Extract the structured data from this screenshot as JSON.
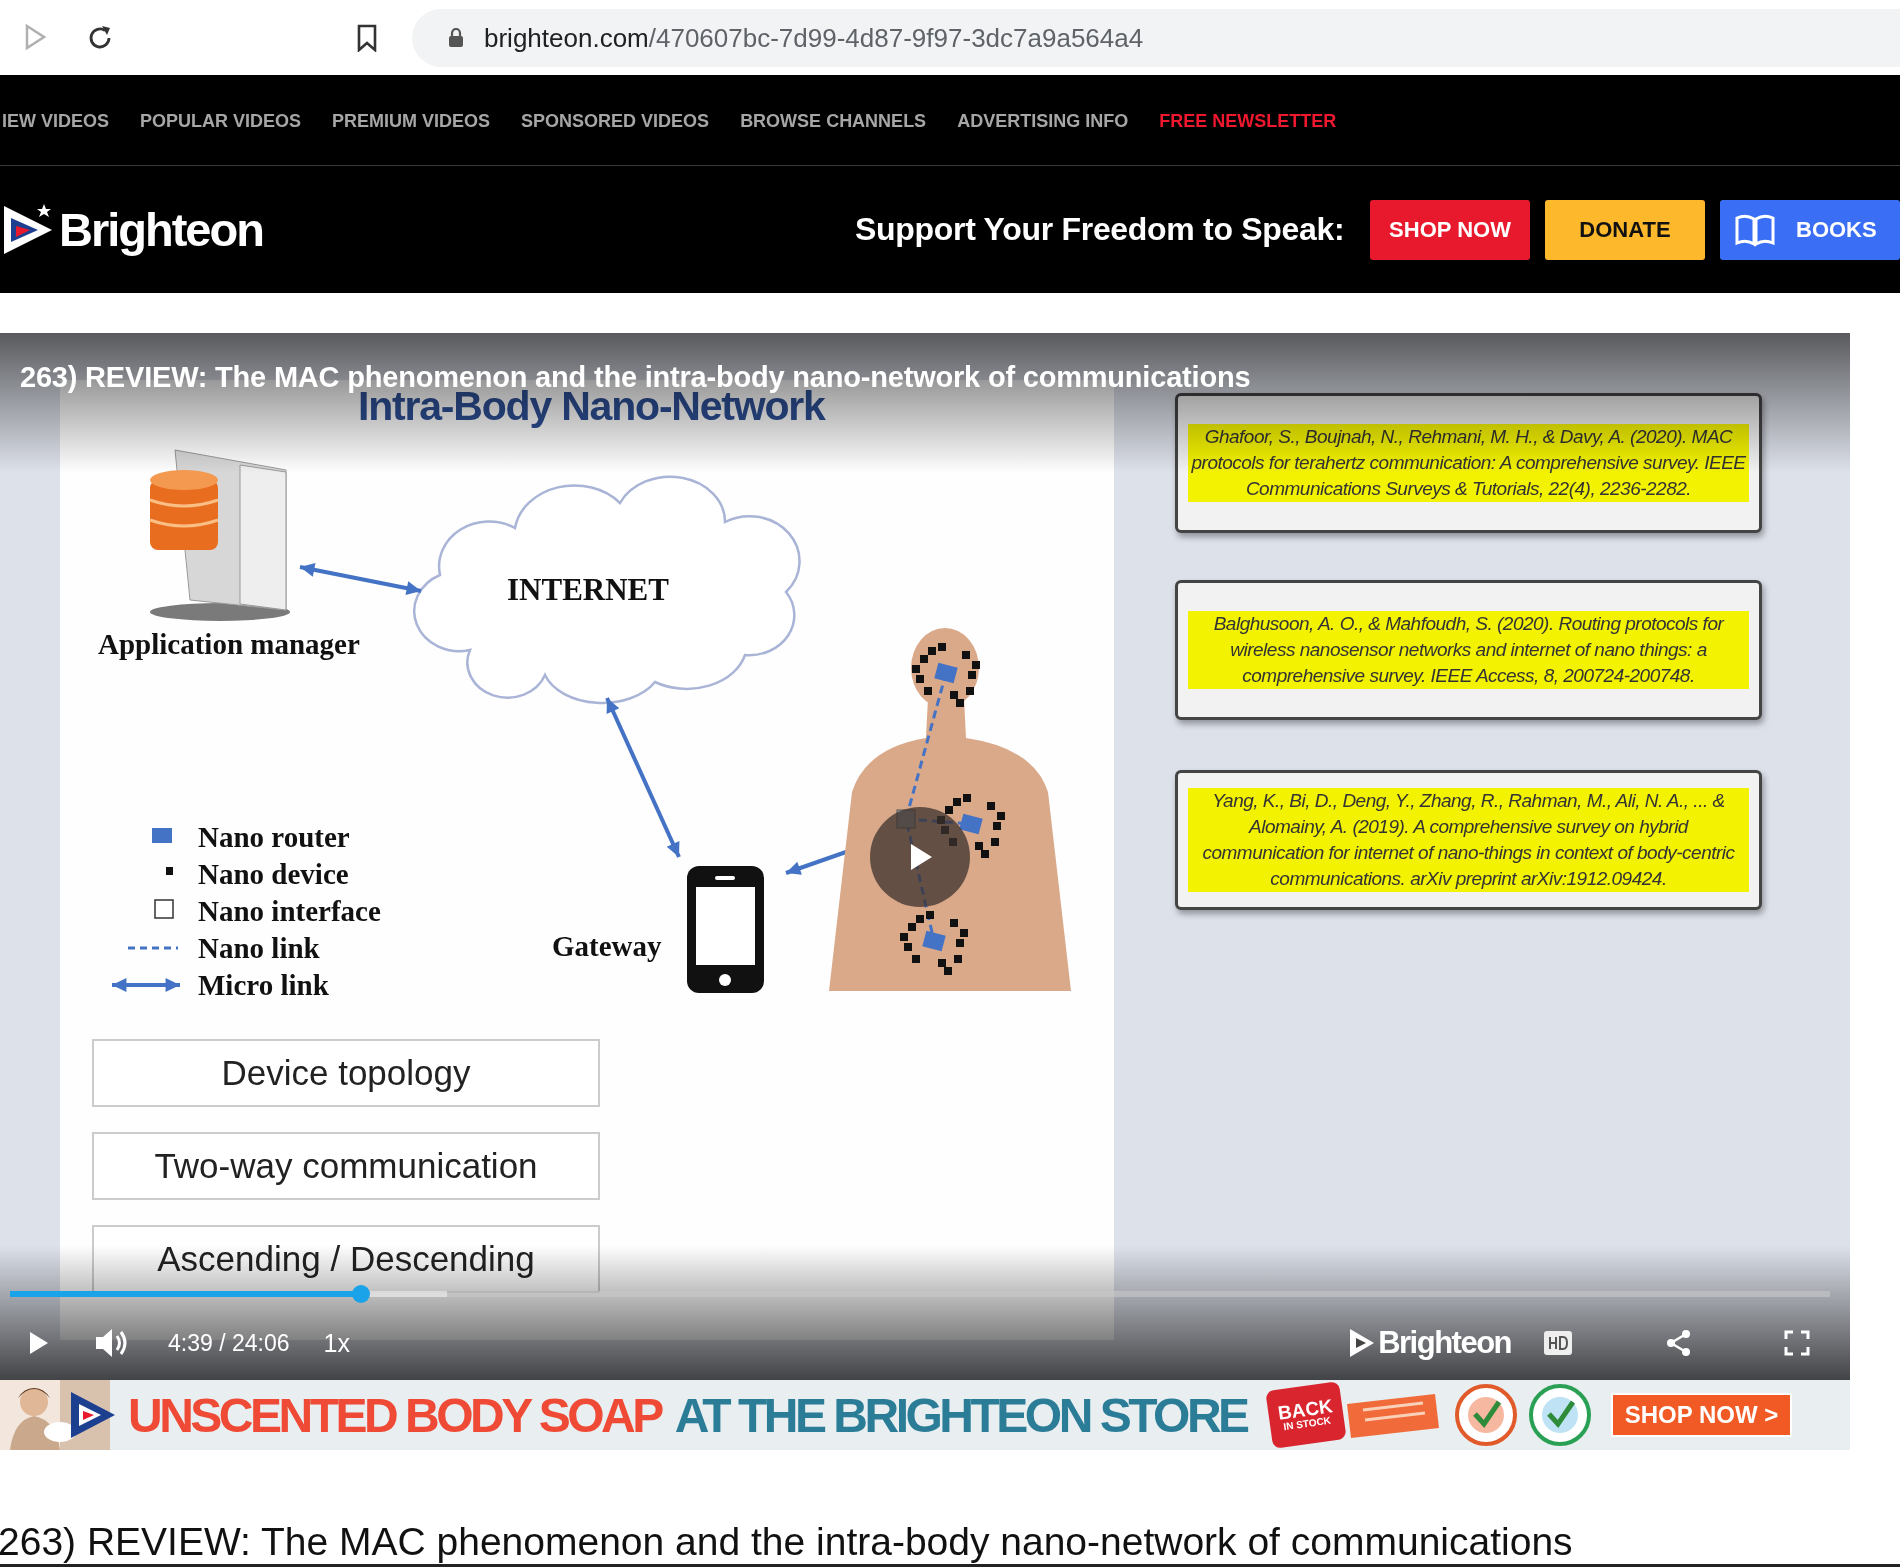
{
  "browser": {
    "url_domain": "brighteon.com",
    "url_path": "/470607bc-7d99-4d87-9f97-3dc7a9a564a4"
  },
  "nav": [
    {
      "label": "IEW VIDEOS",
      "highlight": false
    },
    {
      "label": "POPULAR VIDEOS",
      "highlight": false
    },
    {
      "label": "PREMIUM VIDEOS",
      "highlight": false
    },
    {
      "label": "SPONSORED VIDEOS",
      "highlight": false
    },
    {
      "label": "BROWSE CHANNELS",
      "highlight": false
    },
    {
      "label": "ADVERTISING INFO",
      "highlight": false
    },
    {
      "label": "FREE NEWSLETTER",
      "highlight": true
    }
  ],
  "header": {
    "logo": "Brighteon",
    "tagline": "Support Your Freedom to Speak:",
    "buttons": [
      {
        "label": "SHOP NOW",
        "kind": "shop"
      },
      {
        "label": "DONATE",
        "kind": "donate"
      },
      {
        "label": "BOOKS",
        "kind": "books"
      }
    ]
  },
  "video": {
    "title": "263) REVIEW: The MAC phenomenon and the intra-body nano-network of communications",
    "slide": {
      "heading": "Intra-Body Nano-Network",
      "app_label": "Application manager",
      "internet_label": "INTERNET",
      "gateway_label": "Gateway",
      "legend": [
        {
          "kind": "router",
          "label": "Nano router"
        },
        {
          "kind": "device",
          "label": "Nano device"
        },
        {
          "kind": "interface",
          "label": "Nano interface"
        },
        {
          "kind": "nanolink",
          "label": "Nano link"
        },
        {
          "kind": "microlink",
          "label": "Micro link"
        }
      ],
      "topics": [
        "Device topology",
        "Two-way communication",
        "Ascending / Descending"
      ],
      "references": [
        "Ghafoor, S., Boujnah, N., Rehmani, M. H., & Davy, A. (2020). MAC protocols for terahertz communication: A comprehensive survey. IEEE Communications Surveys & Tutorials, 22(4), 2236-2282.",
        "Balghusoon, A. O., & Mahfoudh, S. (2020). Routing protocols for wireless nanosensor networks and internet of nano things: a comprehensive survey. IEEE Access, 8, 200724-200748.",
        "Yang, K., Bi, D., Deng, Y., Zhang, R., Rahman, M., Ali, N. A., ... & Alomainy, A. (2019). A comprehensive survey on hybrid communication for internet of nano-things in context of body-centric communications. arXiv preprint arXiv:1912.09424."
      ]
    },
    "progress": {
      "level": 0.193
    },
    "buffer": {
      "level": 0.24
    },
    "time": "4:39 / 24:06",
    "speed": "1x",
    "logo": "Brighteon"
  },
  "ad": {
    "headline_1": "UNSCENTED BODY SOAP",
    "headline_2": "AT THE BRIGHTEON STORE",
    "badge_1": "BACK",
    "badge_2": "IN STOCK",
    "button": "SHOP NOW >"
  },
  "page_title": "263) REVIEW: The MAC phenomenon and the intra-body nano-network of communications"
}
